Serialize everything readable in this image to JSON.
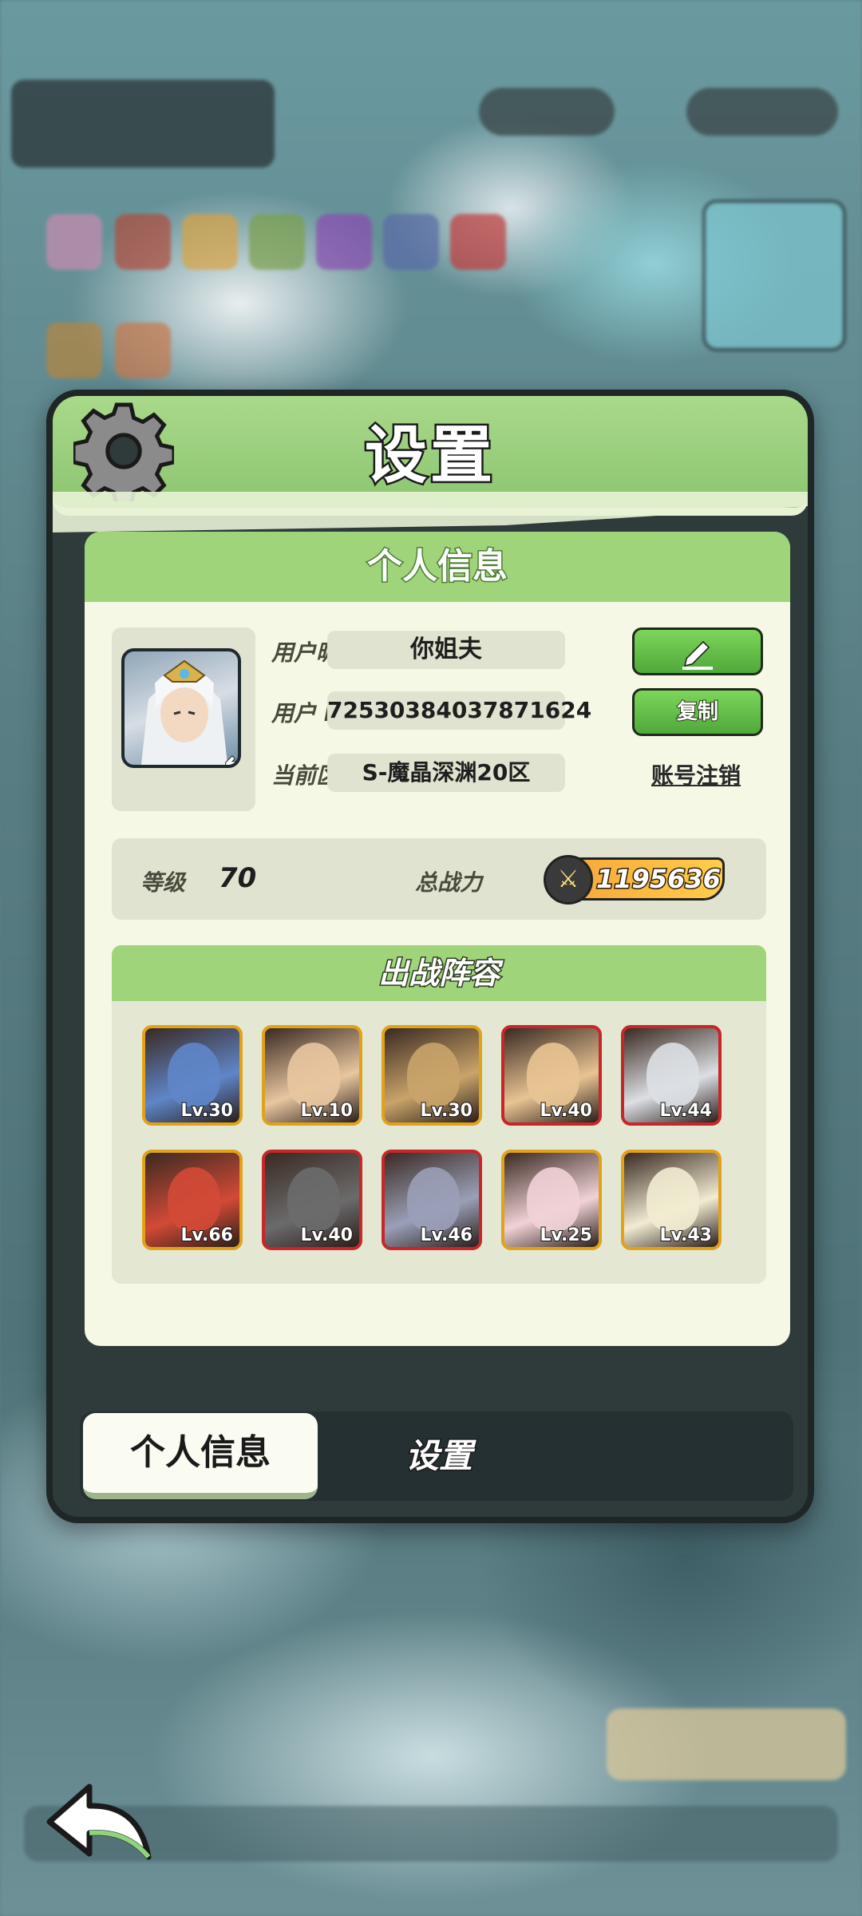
{
  "panel": {
    "title": "设置",
    "section_title": "个人信息"
  },
  "profile": {
    "nickname_label": "用户昵称",
    "nickname": "你姐夫",
    "id_label": "用户 ID",
    "id": "72530384037871624",
    "server_label": "当前区服",
    "server": "S-魔晶深渊20区",
    "copy_label": "复制",
    "cancel_account_label": "账号注销"
  },
  "stats": {
    "level_label": "等级",
    "level": "70",
    "power_label": "总战力",
    "power": "1195636"
  },
  "team": {
    "title": "出战阵容",
    "heroes": [
      {
        "lv": "Lv.30",
        "frame": "gold",
        "color": "#5f86c9"
      },
      {
        "lv": "Lv.10",
        "frame": "gold",
        "color": "#e8c7a0"
      },
      {
        "lv": "Lv.30",
        "frame": "gold",
        "color": "#c9a46a"
      },
      {
        "lv": "Lv.40",
        "frame": "red",
        "color": "#e9c493"
      },
      {
        "lv": "Lv.44",
        "frame": "red",
        "color": "#dcdfe3"
      },
      {
        "lv": "Lv.66",
        "frame": "gold",
        "color": "#d24a36"
      },
      {
        "lv": "Lv.40",
        "frame": "red",
        "color": "#6b6b6b"
      },
      {
        "lv": "Lv.46",
        "frame": "red",
        "color": "#9aa0b8"
      },
      {
        "lv": "Lv.25",
        "frame": "gold",
        "color": "#f1d3d6"
      },
      {
        "lv": "Lv.43",
        "frame": "gold",
        "color": "#f2ecd2"
      }
    ]
  },
  "tabs": {
    "active": "个人信息",
    "other": "设置"
  },
  "icons": {
    "gear": "gear-icon",
    "edit": "pencil-icon",
    "swap": "swap-icon",
    "power": "crossed-swords-icon",
    "back": "back-arrow-icon"
  },
  "colors": {
    "accent_green": "#9fd47b",
    "button_green": "#4fa83a",
    "power_orange": "#f4a23a",
    "frame_gold": "#e0a21a",
    "frame_red": "#c7262a"
  }
}
